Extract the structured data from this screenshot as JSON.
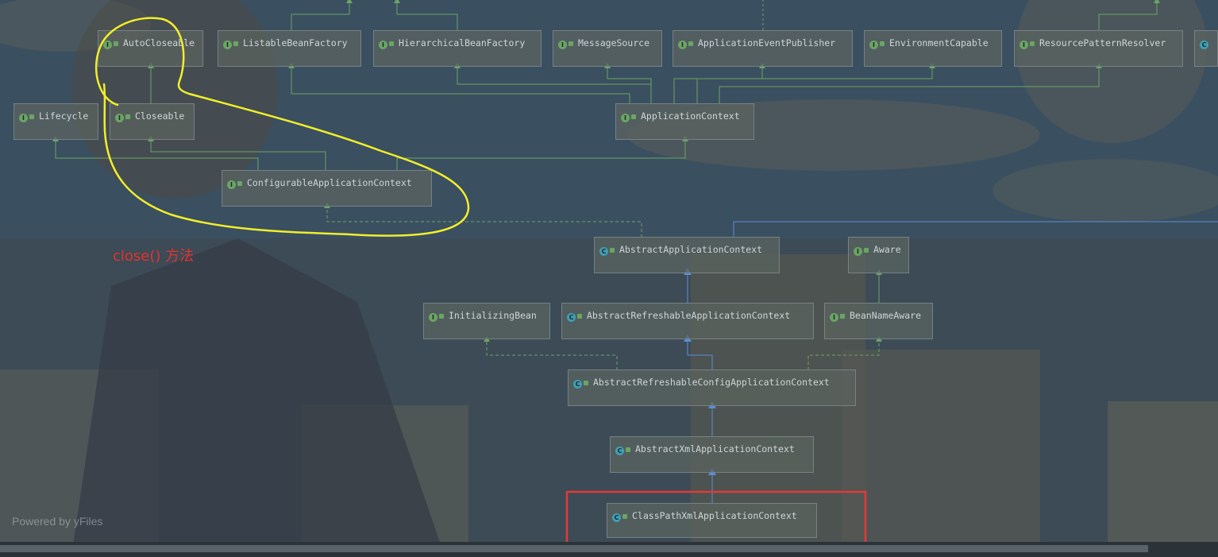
{
  "diagram": {
    "nodes": [
      {
        "id": "auto_closeable",
        "label": "AutoCloseable",
        "kind": "interface"
      },
      {
        "id": "listable_bean_factory",
        "label": "ListableBeanFactory",
        "kind": "interface"
      },
      {
        "id": "hierarchical_bean_factory",
        "label": "HierarchicalBeanFactory",
        "kind": "interface"
      },
      {
        "id": "message_source",
        "label": "MessageSource",
        "kind": "interface"
      },
      {
        "id": "application_event_publisher",
        "label": "ApplicationEventPublisher",
        "kind": "interface"
      },
      {
        "id": "environment_capable",
        "label": "EnvironmentCapable",
        "kind": "interface"
      },
      {
        "id": "resource_pattern_resolver",
        "label": "ResourcePatternResolver",
        "kind": "interface"
      },
      {
        "id": "lifecycle",
        "label": "Lifecycle",
        "kind": "interface"
      },
      {
        "id": "closeable",
        "label": "Closeable",
        "kind": "interface"
      },
      {
        "id": "application_context",
        "label": "ApplicationContext",
        "kind": "interface"
      },
      {
        "id": "configurable_application_context",
        "label": "ConfigurableApplicationContext",
        "kind": "interface"
      },
      {
        "id": "abstract_application_context",
        "label": "AbstractApplicationContext",
        "kind": "abstract"
      },
      {
        "id": "aware",
        "label": "Aware",
        "kind": "interface"
      },
      {
        "id": "initializing_bean",
        "label": "InitializingBean",
        "kind": "interface"
      },
      {
        "id": "abstract_refreshable_application_context",
        "label": "AbstractRefreshableApplicationContext",
        "kind": "abstract"
      },
      {
        "id": "bean_name_aware",
        "label": "BeanNameAware",
        "kind": "interface"
      },
      {
        "id": "abstract_refreshable_config_application_context",
        "label": "AbstractRefreshableConfigApplicationContext",
        "kind": "abstract"
      },
      {
        "id": "abstract_xml_application_context",
        "label": "AbstractXmlApplicationContext",
        "kind": "abstract"
      },
      {
        "id": "class_path_xml_application_context",
        "label": "ClassPathXmlApplicationContext",
        "kind": "class"
      }
    ],
    "edges": [
      {
        "from": "closeable",
        "to": "auto_closeable",
        "type": "extends"
      },
      {
        "from": "application_context",
        "to": "listable_bean_factory",
        "type": "extends"
      },
      {
        "from": "application_context",
        "to": "hierarchical_bean_factory",
        "type": "extends"
      },
      {
        "from": "application_context",
        "to": "message_source",
        "type": "extends"
      },
      {
        "from": "application_context",
        "to": "application_event_publisher",
        "type": "extends"
      },
      {
        "from": "application_context",
        "to": "environment_capable",
        "type": "extends"
      },
      {
        "from": "application_context",
        "to": "resource_pattern_resolver",
        "type": "extends"
      },
      {
        "from": "configurable_application_context",
        "to": "lifecycle",
        "type": "extends"
      },
      {
        "from": "configurable_application_context",
        "to": "closeable",
        "type": "extends"
      },
      {
        "from": "configurable_application_context",
        "to": "application_context",
        "type": "extends"
      },
      {
        "from": "abstract_application_context",
        "to": "configurable_application_context",
        "type": "implements"
      },
      {
        "from": "abstract_refreshable_application_context",
        "to": "abstract_application_context",
        "type": "extends"
      },
      {
        "from": "bean_name_aware",
        "to": "aware",
        "type": "extends"
      },
      {
        "from": "abstract_refreshable_config_application_context",
        "to": "abstract_refreshable_application_context",
        "type": "extends"
      },
      {
        "from": "abstract_refreshable_config_application_context",
        "to": "initializing_bean",
        "type": "implements"
      },
      {
        "from": "abstract_refreshable_config_application_context",
        "to": "bean_name_aware",
        "type": "implements"
      },
      {
        "from": "abstract_xml_application_context",
        "to": "abstract_refreshable_config_application_context",
        "type": "extends"
      },
      {
        "from": "class_path_xml_application_context",
        "to": "abstract_xml_application_context",
        "type": "extends"
      }
    ]
  },
  "annotation": {
    "text": "close() 方法"
  },
  "watermark": "Powered by yFiles",
  "colors": {
    "extends_edge": "#5b8fd8",
    "implements_edge": "#6aa565",
    "uncolored_edge": "#93a3aa",
    "highlight_curve": "#f2ee2a",
    "highlight_box": "#e23a36",
    "annotation_text": "#e5322d",
    "interface_icon": "#6aa565",
    "class_icon": "#3f9fb8"
  }
}
